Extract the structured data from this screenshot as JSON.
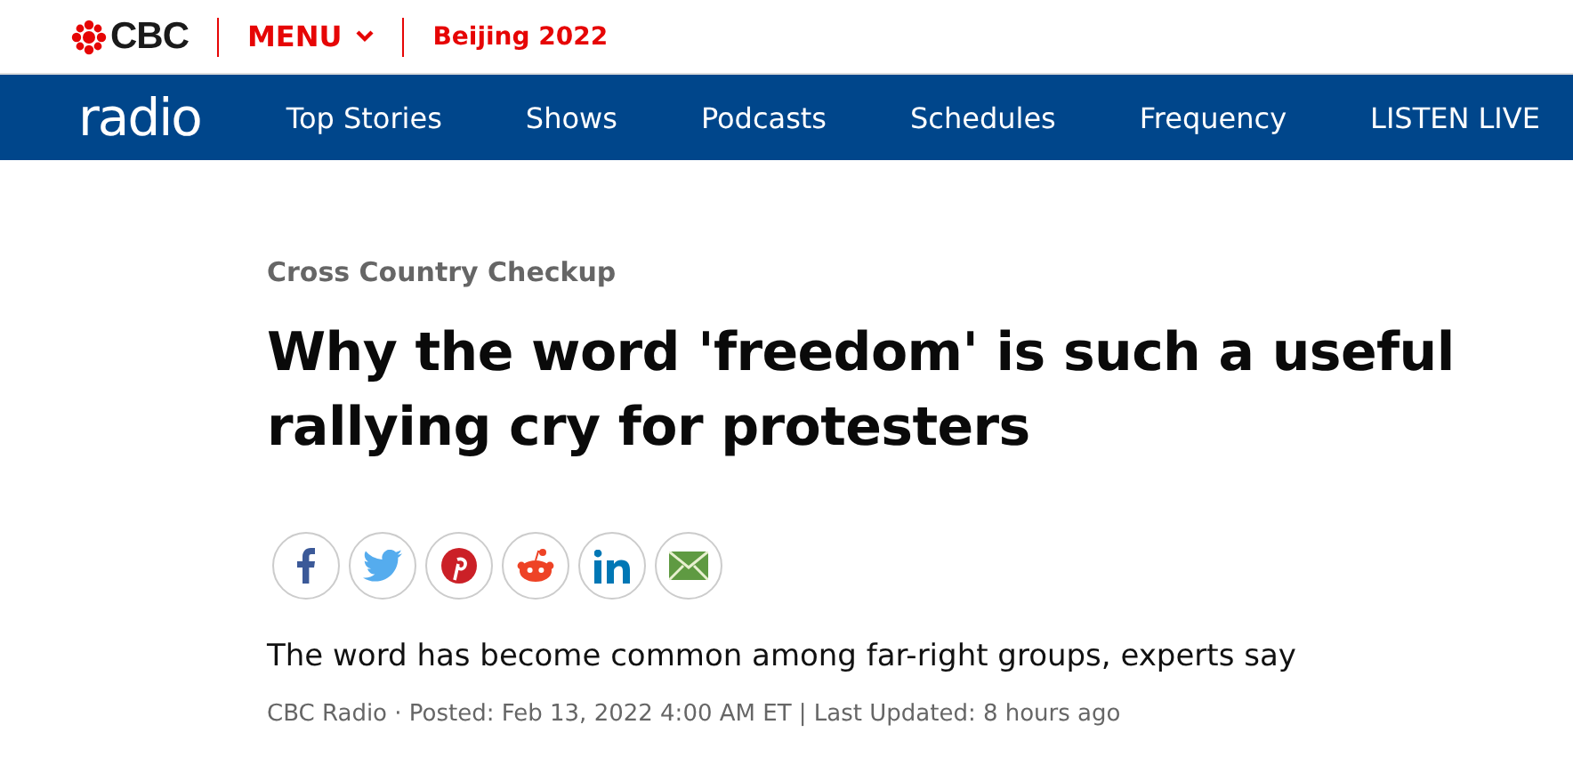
{
  "header": {
    "logo": "CBC",
    "menu": "MENU",
    "link": "Beijing 2022"
  },
  "nav": {
    "brand": "radio",
    "items": [
      "Top Stories",
      "Shows",
      "Podcasts",
      "Schedules",
      "Frequency",
      "LISTEN LIVE"
    ]
  },
  "article": {
    "kicker": "Cross Country Checkup",
    "headline": "Why the word 'freedom' is such a useful rallying cry for protesters",
    "share": [
      {
        "kind": "facebook"
      },
      {
        "kind": "twitter"
      },
      {
        "kind": "pinterest"
      },
      {
        "kind": "reddit"
      },
      {
        "kind": "linkedin"
      },
      {
        "kind": "email"
      }
    ],
    "deck": "The word has become common among far-right groups, experts say",
    "byline": "CBC Radio · Posted: Feb 13, 2022 4:00 AM ET | Last Updated: 8 hours ago"
  }
}
